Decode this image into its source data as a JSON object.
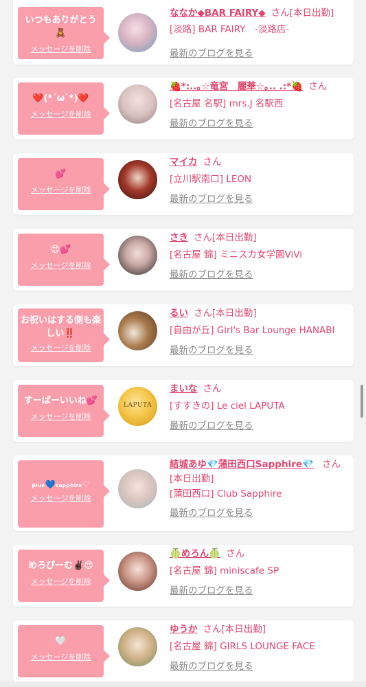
{
  "accent_color": "#fb9eac",
  "name_color": "#e0466e",
  "delete_label": "メッセージを削除",
  "blog_label": "最新のブログを見る",
  "cards": [
    {
      "message": "いつもありがとう🧸",
      "name": "ななか◆BAR FAIRY◆",
      "suffix": "さん[本日出勤]",
      "shop": "[淡路] BAR FAIRY　-淡路店-",
      "avatar_icon": "avatar-photo"
    },
    {
      "message": "❤️(*´ω`*)❤️",
      "name": "🍓*:..｡☆竜宮　麗華☆｡.. .:*🍓",
      "suffix": "さん",
      "shop": "[名古屋 名駅] mrs.J 名駅西",
      "avatar_icon": "avatar-photo"
    },
    {
      "message": "💕",
      "name": "マイカ",
      "suffix": "さん",
      "shop": "[立川駅南口] LEON",
      "avatar_icon": "avatar-photo"
    },
    {
      "message": "😍💕",
      "name": "さき",
      "suffix": "さん[本日出勤]",
      "shop": "[名古屋 錦] ミニスカ女学園ViVi",
      "avatar_icon": "avatar-photo"
    },
    {
      "message": "お祝いはする側も楽しい‼️",
      "name": "るい",
      "suffix": "さん[本日出勤]",
      "shop": "[自由が丘] Girl's Bar Lounge HANABI",
      "avatar_icon": "avatar-photo"
    },
    {
      "message": "すーぱーいいね💕",
      "name": "まいな",
      "suffix": "さん",
      "shop": "[すすきの] Le ciel LAPUTA",
      "avatar_icon": "avatar-logo",
      "avatar_text": "LAPUTA"
    },
    {
      "message": "ᵦₗᵤₑ💙ₛₐₚₚₕᵢᵣₑ♡",
      "name": "結城あゆ💎蒲田西口Sapphire💎",
      "suffix": "さん",
      "suffix2": "[本日出勤]",
      "shop": "[蒲田西口] Club Sapphire",
      "avatar_icon": "avatar-photo"
    },
    {
      "message": "めろぴーむ✌🏿😍",
      "name": "🍈めろん🍈",
      "suffix": "さん",
      "shop": "[名古屋 錦] miniscafe SP",
      "avatar_icon": "avatar-photo"
    },
    {
      "message": "🤍",
      "name": "ゆうか",
      "suffix": "さん[本日出勤]",
      "shop": "[名古屋 錦] GIRLS LOUNGE FACE",
      "avatar_icon": "avatar-photo"
    }
  ]
}
